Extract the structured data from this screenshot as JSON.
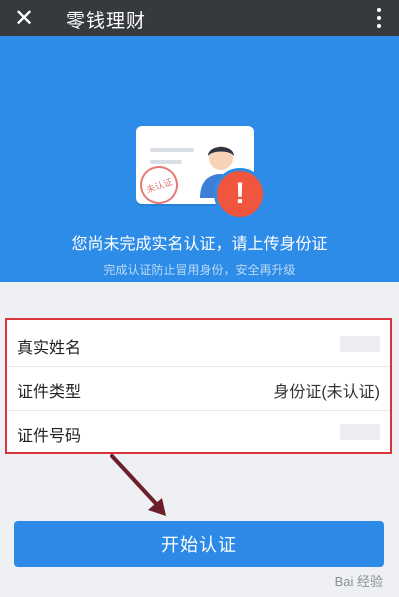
{
  "header": {
    "close_glyph": "✕",
    "title": "零钱理财"
  },
  "hero": {
    "seal_text": "未认证",
    "alert_glyph": "!",
    "main_message": "您尚未完成实名认证，请上传身份证",
    "sub_message": "完成认证防止冒用身份，安全再升级"
  },
  "form": {
    "rows": [
      {
        "label": "真实姓名",
        "value": ""
      },
      {
        "label": "证件类型",
        "value": "身份证(未认证)"
      },
      {
        "label": "证件号码",
        "value": ""
      }
    ]
  },
  "actions": {
    "start_label": "开始认证"
  },
  "watermark": {
    "text": "Bai 经验"
  },
  "colors": {
    "topbar": "#36393e",
    "hero_blue": "#2d8ce8",
    "button_blue": "#2c89e6",
    "highlight_red": "#d9343a",
    "alert_red": "#f0563e"
  }
}
